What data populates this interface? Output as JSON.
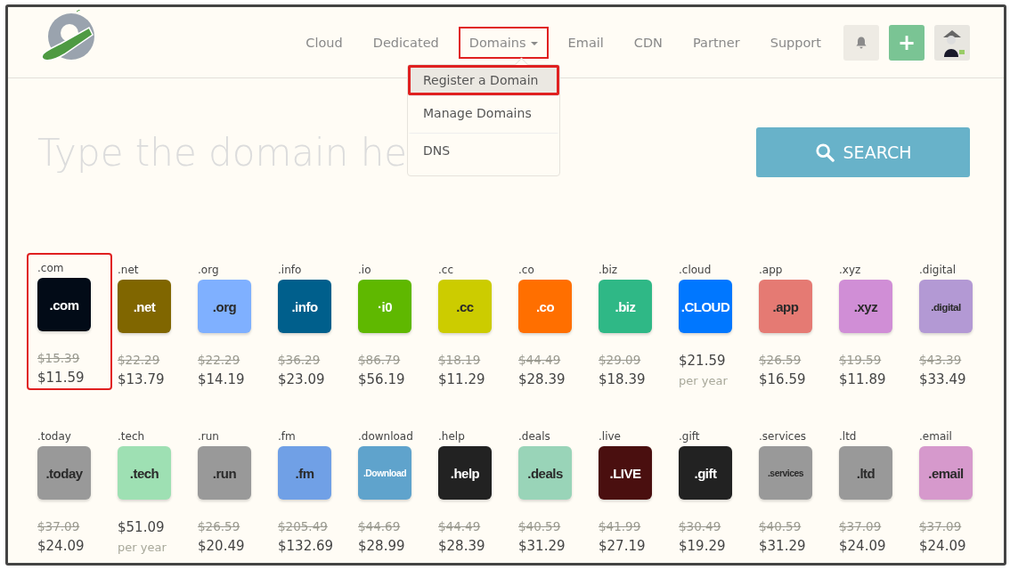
{
  "nav": [
    {
      "label": "Cloud",
      "dropdown": false,
      "highlighted": false
    },
    {
      "label": "Dedicated",
      "dropdown": false,
      "highlighted": false
    },
    {
      "label": "Domains",
      "dropdown": true,
      "highlighted": true
    },
    {
      "label": "Email",
      "dropdown": false,
      "highlighted": false
    },
    {
      "label": "CDN",
      "dropdown": false,
      "highlighted": false
    },
    {
      "label": "Partner",
      "dropdown": false,
      "highlighted": false
    },
    {
      "label": "Support",
      "dropdown": false,
      "highlighted": false
    }
  ],
  "plus_button": {
    "label": "+"
  },
  "dropdown": {
    "expanded": true,
    "items": [
      {
        "label": "Register a Domain",
        "selected": true,
        "highlighted": true
      },
      {
        "label": "Manage Domains",
        "selected": false,
        "highlighted": false
      },
      {
        "label": "DNS",
        "selected": false,
        "highlighted": false
      }
    ]
  },
  "search": {
    "placeholder": "Type the domain he",
    "button": "SEARCH"
  },
  "domains": [
    {
      "tld": ".com",
      "logo_text": ".com",
      "color": "#020b17",
      "old_price": "$15.39",
      "price": "$11.59",
      "highlighted": true
    },
    {
      "tld": ".net",
      "logo_text": ".net",
      "color": "#806600",
      "old_price": "$22.29",
      "price": "$13.79",
      "highlighted": false
    },
    {
      "tld": ".org",
      "logo_text": ".org",
      "color": "#7fb0ff",
      "old_price": "$22.29",
      "price": "$14.19",
      "highlighted": false
    },
    {
      "tld": ".info",
      "logo_text": ".info",
      "color": "#005f8c",
      "old_price": "$36.29",
      "price": "$23.09",
      "highlighted": false
    },
    {
      "tld": ".io",
      "logo_text": "·i0",
      "color": "#5fb800",
      "old_price": "$86.79",
      "price": "$56.19",
      "highlighted": false
    },
    {
      "tld": ".cc",
      "logo_text": ".cc",
      "color": "#cccc00",
      "old_price": "$18.19",
      "price": "$11.29",
      "highlighted": false
    },
    {
      "tld": ".co",
      "logo_text": ".co",
      "color": "#ff6f00",
      "old_price": "$44.49",
      "price": "$28.39",
      "highlighted": false
    },
    {
      "tld": ".biz",
      "logo_text": ".biz",
      "color": "#2fb886",
      "old_price": "$29.09",
      "price": "$18.39",
      "highlighted": false
    },
    {
      "tld": ".cloud",
      "logo_text": ".CLOUD",
      "color": "#0077ff",
      "price": "$21.59",
      "note": "per year",
      "highlighted": false
    },
    {
      "tld": ".app",
      "logo_text": ".app",
      "color": "#e57a73",
      "old_price": "$26.59",
      "price": "$16.59",
      "highlighted": false
    },
    {
      "tld": ".xyz",
      "logo_text": ".xyz",
      "color": "#d08ed6",
      "old_price": "$19.59",
      "price": "$11.89",
      "highlighted": false
    },
    {
      "tld": ".digital",
      "logo_text": ".digital",
      "color": "#b399d4",
      "old_price": "$43.39",
      "price": "$33.49",
      "highlighted": false
    },
    {
      "tld": ".today",
      "logo_text": ".today",
      "color": "#999999",
      "old_price": "$37.09",
      "price": "$24.09",
      "highlighted": false
    },
    {
      "tld": ".tech",
      "logo_text": ".tech",
      "color": "#9ee0b3",
      "price": "$51.09",
      "note": "per year",
      "highlighted": false
    },
    {
      "tld": ".run",
      "logo_text": ".run",
      "color": "#999999",
      "old_price": "$26.59",
      "price": "$20.49",
      "highlighted": false
    },
    {
      "tld": ".fm",
      "logo_text": ".fm",
      "color": "#70a0e6",
      "old_price": "$205.49",
      "price": "$132.69",
      "highlighted": false
    },
    {
      "tld": ".download",
      "logo_text": ".Download",
      "color": "#5fa3cc",
      "old_price": "$44.69",
      "price": "$28.99",
      "highlighted": false
    },
    {
      "tld": ".help",
      "logo_text": ".help",
      "color": "#222222",
      "old_price": "$44.49",
      "price": "$28.39",
      "highlighted": false
    },
    {
      "tld": ".deals",
      "logo_text": ".deals",
      "color": "#99d4b8",
      "old_price": "$40.59",
      "price": "$31.29",
      "highlighted": false
    },
    {
      "tld": ".live",
      "logo_text": ".LIVE",
      "color": "#4a0f0f",
      "old_price": "$41.99",
      "price": "$27.19",
      "highlighted": false
    },
    {
      "tld": ".gift",
      "logo_text": ".gift",
      "color": "#222222",
      "old_price": "$30.49",
      "price": "$19.29",
      "highlighted": false
    },
    {
      "tld": ".services",
      "logo_text": ".services",
      "color": "#999999",
      "old_price": "$40.59",
      "price": "$31.29",
      "highlighted": false
    },
    {
      "tld": ".ltd",
      "logo_text": ".ltd",
      "color": "#999999",
      "old_price": "$37.09",
      "price": "$24.09",
      "highlighted": false
    },
    {
      "tld": ".email",
      "logo_text": ".email",
      "color": "#d699cc",
      "old_price": "$37.09",
      "price": "$24.09",
      "highlighted": false
    }
  ]
}
